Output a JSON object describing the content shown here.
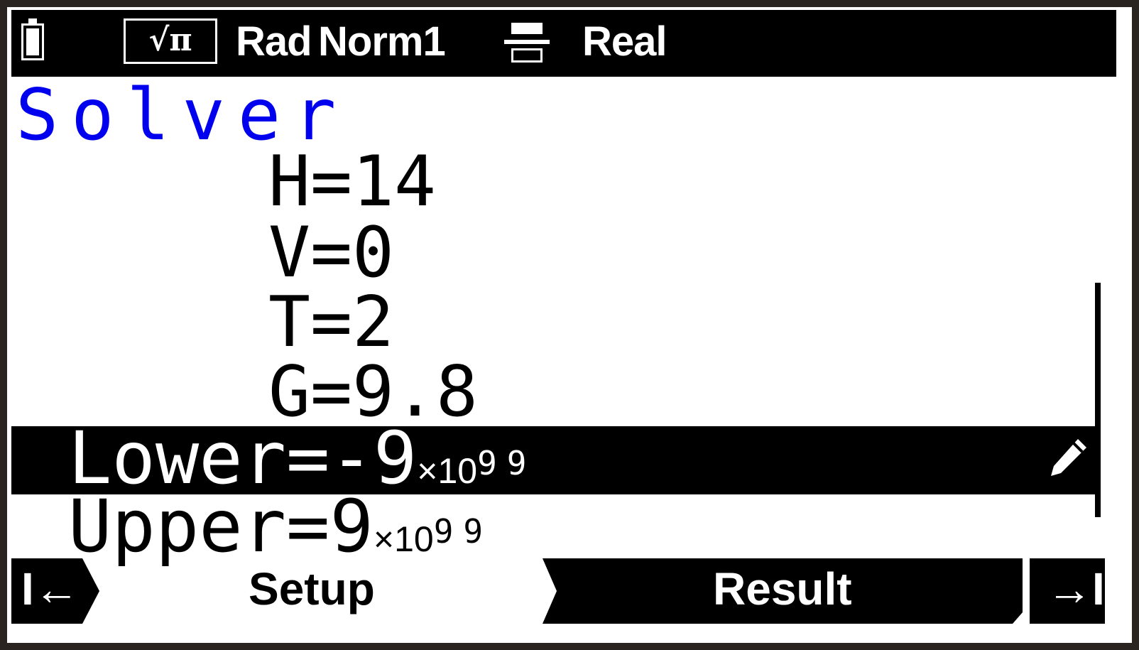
{
  "status": {
    "math_mode": "√π",
    "angle": "Rad",
    "display": "Norm1",
    "complex": "Real",
    "icons": [
      "battery-icon",
      "fraction-format-icon"
    ]
  },
  "title": "Solver",
  "variables": [
    {
      "label": "H=14"
    },
    {
      "label": "V=0"
    },
    {
      "label": "T=2"
    },
    {
      "label": "G=9.8"
    }
  ],
  "range": {
    "lower_prefix": "Lower=-9",
    "upper_prefix": "Upper=9",
    "times_ten": "×10",
    "exponent": "99"
  },
  "menu": {
    "prev_label": "I←",
    "setup_label": "Setup",
    "result_label": "Result",
    "next_label": "→I"
  },
  "colors": {
    "title": "#0000ee",
    "selected_bg": "#000000",
    "background": "#ffffff"
  }
}
